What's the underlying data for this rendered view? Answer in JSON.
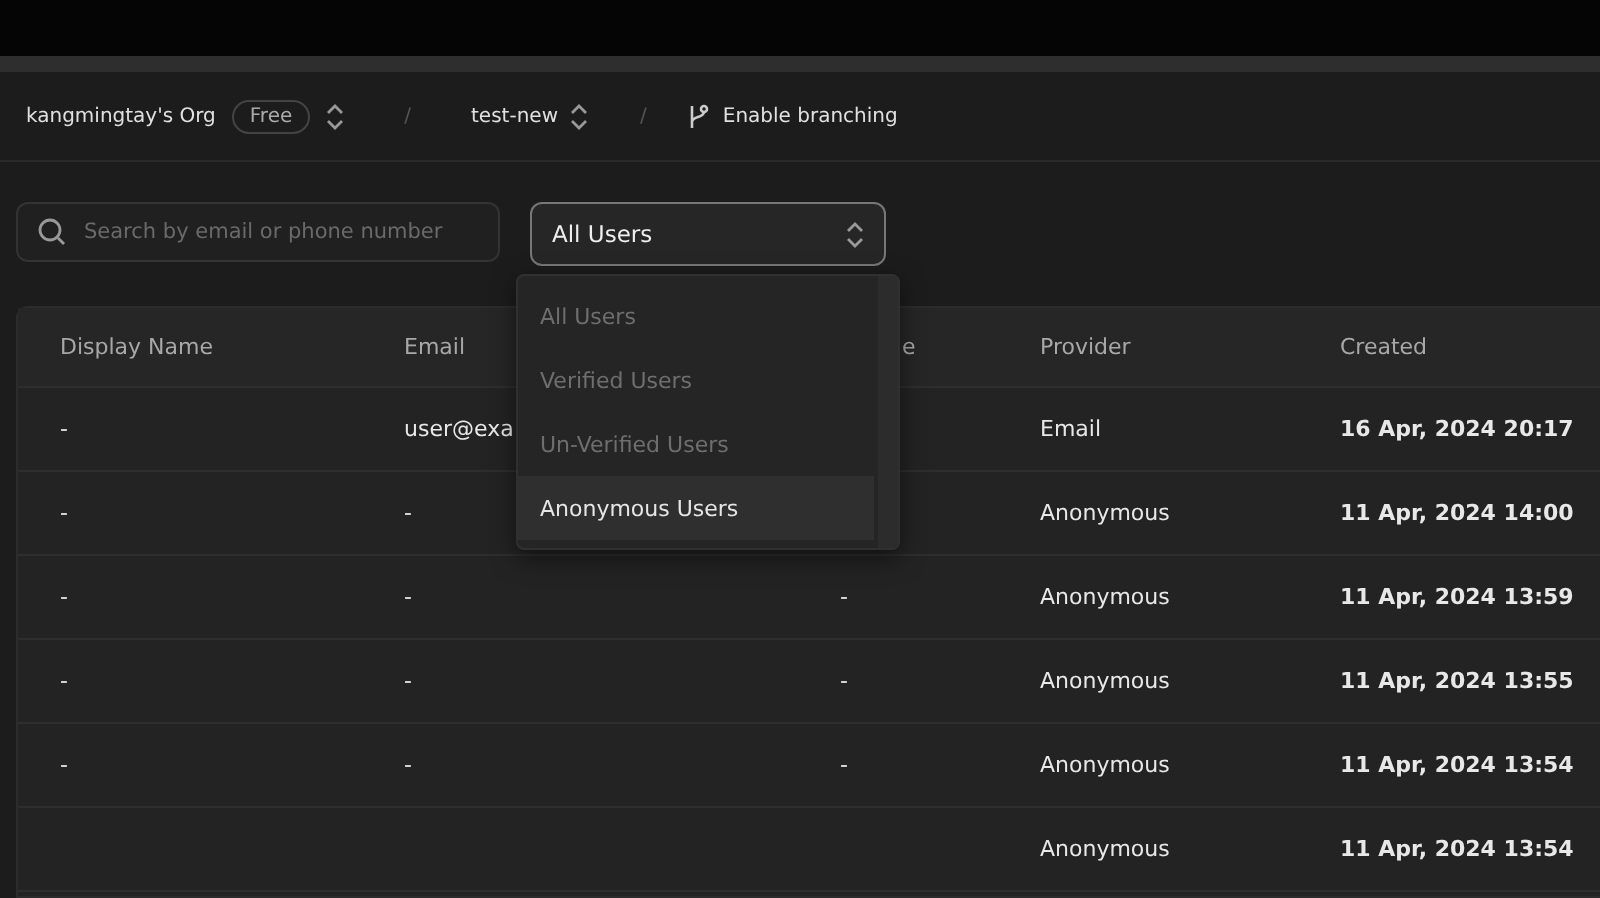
{
  "breadcrumb": {
    "org": "kangmingtay's Org",
    "plan": "Free",
    "separator": "/",
    "project": "test-new",
    "branch_action": "Enable branching"
  },
  "toolbar": {
    "search": {
      "placeholder": "Search by email or phone number"
    },
    "filter": {
      "value": "All Users",
      "expanded": true,
      "options": [
        {
          "label": "All Users",
          "highlighted": false
        },
        {
          "label": "Verified Users",
          "highlighted": false
        },
        {
          "label": "Un-Verified Users",
          "highlighted": false
        },
        {
          "label": "Anonymous Users",
          "highlighted": true
        }
      ]
    }
  },
  "table": {
    "columns": [
      "Display Name",
      "Email",
      "e",
      "Provider",
      "Created"
    ],
    "rows": [
      {
        "display_name": "-",
        "email": "user@exa",
        "provider": "Email",
        "created": "16 Apr, 2024 20:17"
      },
      {
        "display_name": "-",
        "email": "-",
        "provider": "Anonymous",
        "created": "11 Apr, 2024 14:00"
      },
      {
        "display_name": "-",
        "email": "-",
        "column_3": "-",
        "provider": "Anonymous",
        "created": "11 Apr, 2024 13:59"
      },
      {
        "display_name": "-",
        "email": "-",
        "column_3": "-",
        "provider": "Anonymous",
        "created": "11 Apr, 2024 13:55"
      },
      {
        "display_name": "-",
        "email": "-",
        "column_3": "-",
        "provider": "Anonymous",
        "created": "11 Apr, 2024 13:54"
      },
      {
        "provider": "Anonymous",
        "created": "11 Apr, 2024 13:54"
      }
    ]
  }
}
